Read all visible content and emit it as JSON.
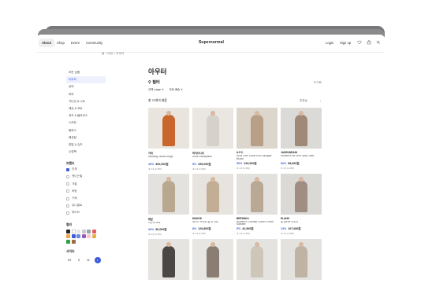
{
  "nav": {
    "tabs": [
      {
        "label": "About",
        "active": true
      },
      {
        "label": "Shop",
        "active": false
      },
      {
        "label": "Event",
        "active": false
      },
      {
        "label": "Community",
        "active": false
      }
    ],
    "brand": "Supernormal",
    "login": "Login",
    "signup": "Sign up",
    "icons": [
      "heart-icon",
      "bag-icon",
      "search-icon"
    ]
  },
  "breadcrumb": {
    "home": "홈",
    "sep1": ">",
    "level1": "여성",
    "sep2": ">",
    "level2": "아우터"
  },
  "sidebar": {
    "items": [
      {
        "label": "모든 상품",
        "active": false
      },
      {
        "label": "아우터",
        "active": true
      },
      {
        "label": "상의",
        "active": false
      },
      {
        "label": "하의",
        "active": false
      },
      {
        "label": "가디건 & 니트",
        "active": false
      },
      {
        "label": "재킷 & 코트",
        "active": false
      },
      {
        "label": "셔츠 & 블라우스",
        "active": false
      },
      {
        "label": "스커트",
        "active": false
      },
      {
        "label": "원피스",
        "active": false
      },
      {
        "label": "패션잡",
        "active": false
      },
      {
        "label": "양말 & 슈즈",
        "active": false
      },
      {
        "label": "수영복",
        "active": false
      }
    ],
    "brand_title": "브랜드",
    "brands": [
      {
        "label": "전체",
        "checked": true
      },
      {
        "label": "앤더슨벨",
        "checked": false
      },
      {
        "label": "가을",
        "checked": false
      },
      {
        "label": "바람",
        "checked": false
      },
      {
        "label": "구례",
        "checked": false
      },
      {
        "label": "유니클로",
        "checked": false
      },
      {
        "label": "파이브",
        "checked": false
      }
    ],
    "color_title": "컬러",
    "colors": [
      "#222222",
      "#ffffff",
      "#e6e6e6",
      "#c9c9c9",
      "#9aa2ad",
      "#e85d5d",
      "#f2a541",
      "#3b5bdb",
      "#6c8ae0",
      "#9b59b6",
      "#f7c6d0",
      "#e8b04b",
      "#2f9e44",
      "#9c6b3f"
    ],
    "size_title": "사이즈",
    "sizes": [
      {
        "label": "XS",
        "active": false
      },
      {
        "label": "S",
        "active": false
      },
      {
        "label": "M",
        "active": false
      },
      {
        "label": "L",
        "active": true
      }
    ]
  },
  "main": {
    "title": "아우터",
    "filter_title": "필터",
    "reset": "초기화",
    "chips": [
      "선택 Large",
      "무료 배송"
    ],
    "count": "총 75개의 제품",
    "sort": "추천순"
  },
  "products": [
    {
      "brand": "가위",
      "name": "Mustang Jacket Beige",
      "disc": "40%",
      "price": "300,000원",
      "rating": "★ 4.8 (2,355)",
      "bg": "#e9e5de",
      "fig": "#c8662d"
    },
    {
      "brand": "파이브니셔",
      "name": "Wool Sweatpants",
      "disc": "5%",
      "price": "299,000원",
      "rating": "★ 4.8 (2,355)",
      "bg": "#eae6e2",
      "fig": "#d6d2cb"
    },
    {
      "brand": "A.P.C.",
      "name": "Wool Over Cable Knit Cardigan Brown",
      "disc": "50%",
      "price": "229,520원",
      "rating": "★ 4.8 (2,355)",
      "bg": "#ddd6cd",
      "fig": "#b89f87"
    },
    {
      "brand": "JANSUNRAIN",
      "name": "Women's Ice Zero Lady Outer",
      "disc": "60%",
      "price": "58,900원",
      "rating": "★ 4.8 (2,355)",
      "bg": "#dcdad6",
      "fig": "#a08978"
    },
    {
      "brand": "테잎",
      "name": "아우터 코트",
      "disc": "32%",
      "price": "56,000원",
      "rating": "★ 4.8 (2,355)",
      "bg": "#e4e2df",
      "fig": "#b9a88f"
    },
    {
      "brand": "MAHOD",
      "name": "레이스 프린트 롱 퍼 코트",
      "disc": "8%",
      "price": "129,800원",
      "rating": "★ 4.8 (2,355)",
      "bg": "#e7e3df",
      "fig": "#c2ad95"
    },
    {
      "brand": "BERSHKA",
      "name": "Women's Contrast Cotton V-neck Sweater",
      "disc": "5%",
      "price": "42,900원",
      "rating": "★ 4.8 (2,355)",
      "bg": "#e3e1dd",
      "fig": "#b8a895"
    },
    {
      "brand": "ELAND",
      "name": "롱 블러브 아우터",
      "disc": "13%",
      "price": "107,080원",
      "rating": "★ 4.8 (2,355)",
      "bg": "#dad9d6",
      "fig": "#9f8e81"
    },
    {
      "brand": "",
      "name": "",
      "disc": "",
      "price": "",
      "rating": "",
      "bg": "#e6e4e1",
      "fig": "#4a4744"
    },
    {
      "brand": "",
      "name": "",
      "disc": "",
      "price": "",
      "rating": "",
      "bg": "#e8e6e3",
      "fig": "#8a7d74"
    },
    {
      "brand": "",
      "name": "",
      "disc": "",
      "price": "",
      "rating": "",
      "bg": "#e5e3df",
      "fig": "#cfc6ba"
    },
    {
      "brand": "",
      "name": "",
      "disc": "",
      "price": "",
      "rating": "",
      "bg": "#e4e2de",
      "fig": "#bfb3a4"
    }
  ]
}
